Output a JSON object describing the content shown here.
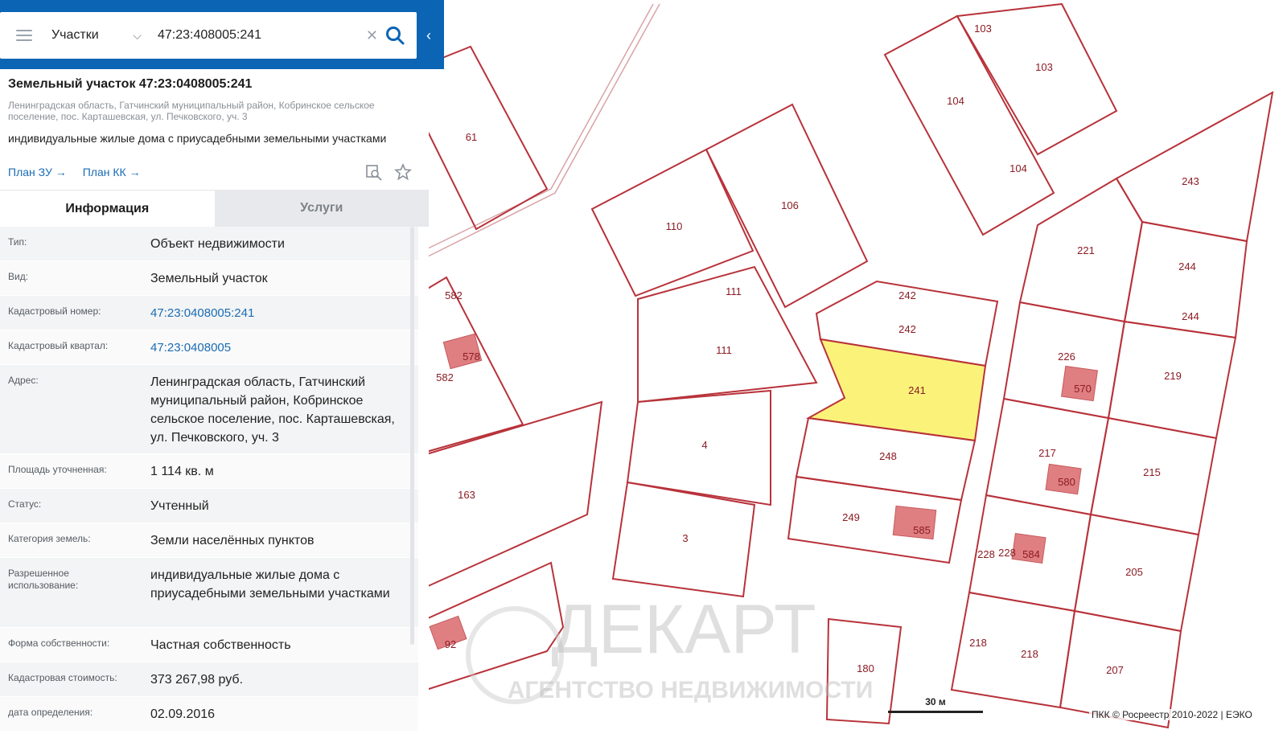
{
  "search": {
    "layer": "Участки",
    "query": "47:23:408005:241"
  },
  "panel": {
    "title": "Земельный участок 47:23:0408005:241",
    "address_short": "Ленинградская область, Гатчинский муниципальный район, Кобринское сельское поселение, пос. Карташевская, ул. Печковского, уч. 3",
    "use_summary": "индивидуальные жилые дома с приусадебными земельными участками",
    "links": [
      "План ЗУ →",
      "План КК →"
    ],
    "tabs": [
      "Информация",
      "Услуги"
    ],
    "rows": [
      {
        "k": "Тип:",
        "v": "Объект недвижимости"
      },
      {
        "k": "Вид:",
        "v": "Земельный участок"
      },
      {
        "k": "Кадастровый номер:",
        "v": "47:23:0408005:241"
      },
      {
        "k": "Кадастровый квартал:",
        "v": "47:23:0408005"
      },
      {
        "k": "Адрес:",
        "v": "Ленинградская область, Гатчинский муниципальный район, Кобринское сельское поселение, пос. Карташевская, ул. Печковского, уч. 3"
      },
      {
        "k": "Площадь уточненная:",
        "v": "1 114 кв. м"
      },
      {
        "k": "Статус:",
        "v": "Учтенный"
      },
      {
        "k": "Категория земель:",
        "v": "Земли населённых пунктов"
      },
      {
        "k": "Разрешенное использование:",
        "v": "индивидуальные жилые дома с приусадебными земельными участками"
      },
      {
        "k": "Форма собственности:",
        "v": "Частная собственность"
      },
      {
        "k": "Кадастровая стоимость:",
        "v": "373 267,98 руб."
      },
      {
        "k": "дата определения:",
        "v": "02.09.2016"
      }
    ]
  },
  "map": {
    "plot_labels": [
      "61",
      "582",
      "578",
      "582",
      "163",
      "92",
      "110",
      "106",
      "111",
      "111",
      "4",
      "3",
      "242",
      "242",
      "241",
      "248",
      "249",
      "585",
      "180",
      "103",
      "103",
      "104",
      "104",
      "243",
      "221",
      "244",
      "244",
      "226",
      "570",
      "219",
      "217",
      "580",
      "215",
      "228",
      "228",
      "584",
      "205",
      "218",
      "218",
      "207"
    ],
    "watermark_title": "ДЕКАРТ",
    "watermark_subtitle": "АГЕНТСТВО НЕДВИЖИМОСТИ",
    "scale_label": "30 м",
    "copyright": "ПКК © Росреестр 2010-2022 | ЕЭКО",
    "colors": {
      "plot_border": "#b8323a",
      "selected_fill": "#fbf27a",
      "building": "#e07f82",
      "accent": "#0b64b4"
    }
  }
}
